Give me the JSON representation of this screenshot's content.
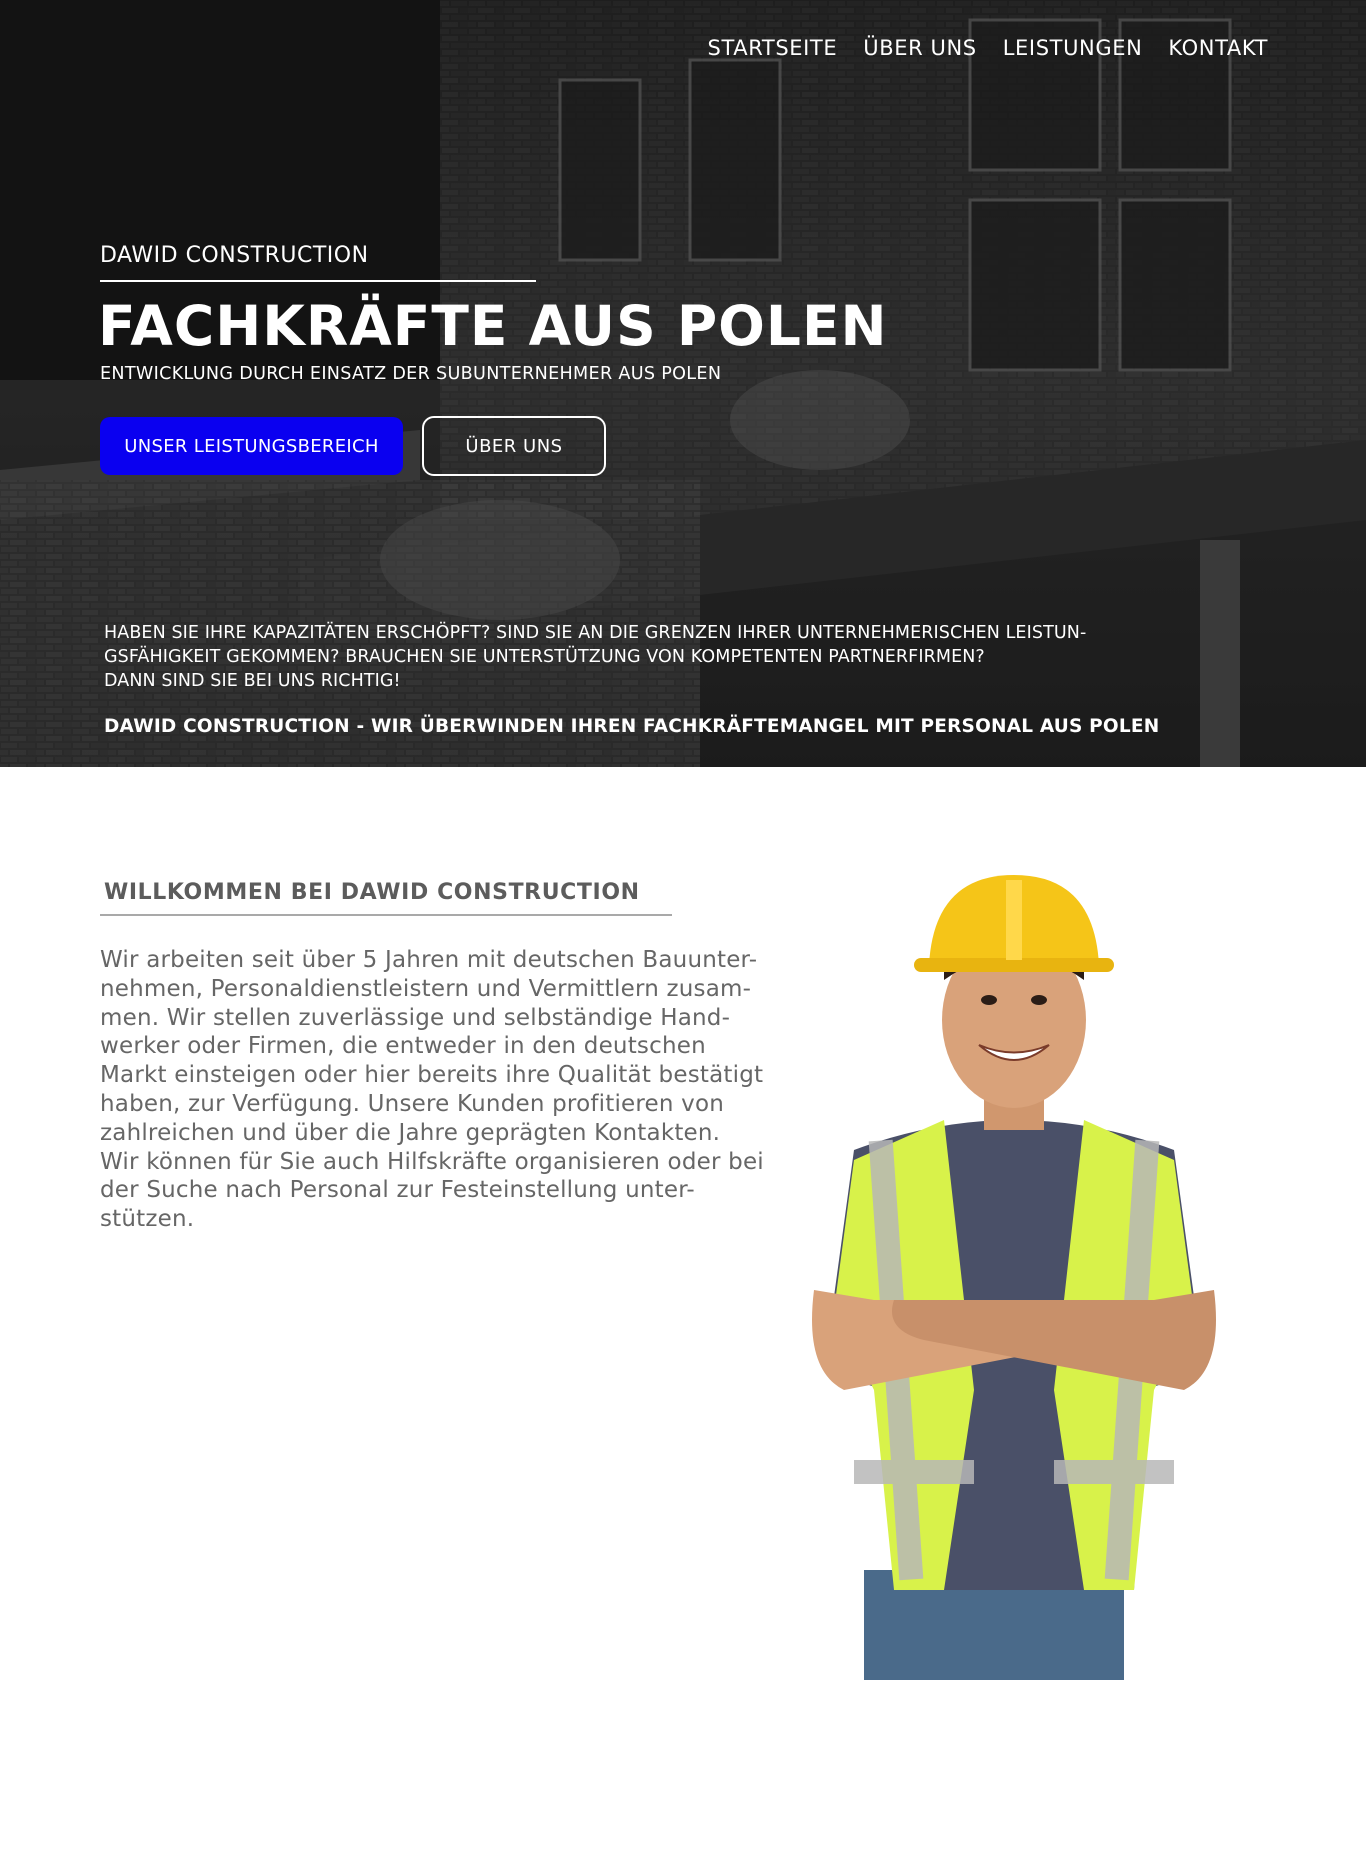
{
  "nav": {
    "items": [
      {
        "label": "STARTSEITE"
      },
      {
        "label": "ÜBER UNS"
      },
      {
        "label": "LEISTUNGEN"
      },
      {
        "label": "KONTAKT"
      }
    ]
  },
  "hero": {
    "brand": "DAWID CONSTRUCTION",
    "title": "FACHKRÄFTE AUS POLEN",
    "subtitle": "ENTWICKLUNG DURCH EINSATZ DER SUBUNTERNEHMER AUS POLEN",
    "primary_button": "UNSER LEISTUNGSBEREICH",
    "secondary_button": "ÜBER UNS",
    "text_lines": [
      "HABEN SIE IHRE KAPAZITÄTEN ERSCHÖPFT? SIND SIE AN DIE GRENZEN IHRER UNTERNEHMERISCHEN LEISTUN-",
      "GSFÄHIGKEIT GEKOMMEN? BRAUCHEN SIE UNTERSTÜTZUNG VON KOMPETENTEN PARTNERFIRMEN?",
      "DANN SIND SIE BEI UNS RICHTIG!"
    ],
    "tagline": "DAWID CONSTRUCTION - WIR ÜBERWINDEN IHREN FACHKRÄFTEMANGEL MIT PERSONAL AUS POLEN"
  },
  "about": {
    "heading_bold": "WILLKOMMEN BEI",
    "heading_rest": " DAWID CONSTRUCTION",
    "lines": [
      "Wir arbeiten seit über 5 Jahren mit deutschen Bauunter-",
      "nehmen, Personaldienstleistern und Vermittlern zusam-",
      "men. Wir stellen zuverlässige und selbständige Hand-",
      "werker oder Firmen, die entweder in den deutschen",
      "Markt einsteigen oder hier bereits ihre Qualität bestätigt",
      "haben, zur Verfügung. Unsere Kunden profitieren von",
      "zahlreichen und über die Jahre geprägten Kontakten.",
      "Wir können für Sie auch Hilfskräfte organisieren oder bei",
      "der Suche nach Personal zur Festeinstellung unter-",
      "stützen."
    ]
  },
  "colors": {
    "primary_button": "#0a00f0",
    "heading_text": "#5c5c5c",
    "body_text": "#666666",
    "vest": "#d8f24a",
    "helmet": "#f5c518"
  },
  "icons": {
    "worker_photo": "construction-worker-image",
    "hero_background": "building-demolition-image"
  }
}
